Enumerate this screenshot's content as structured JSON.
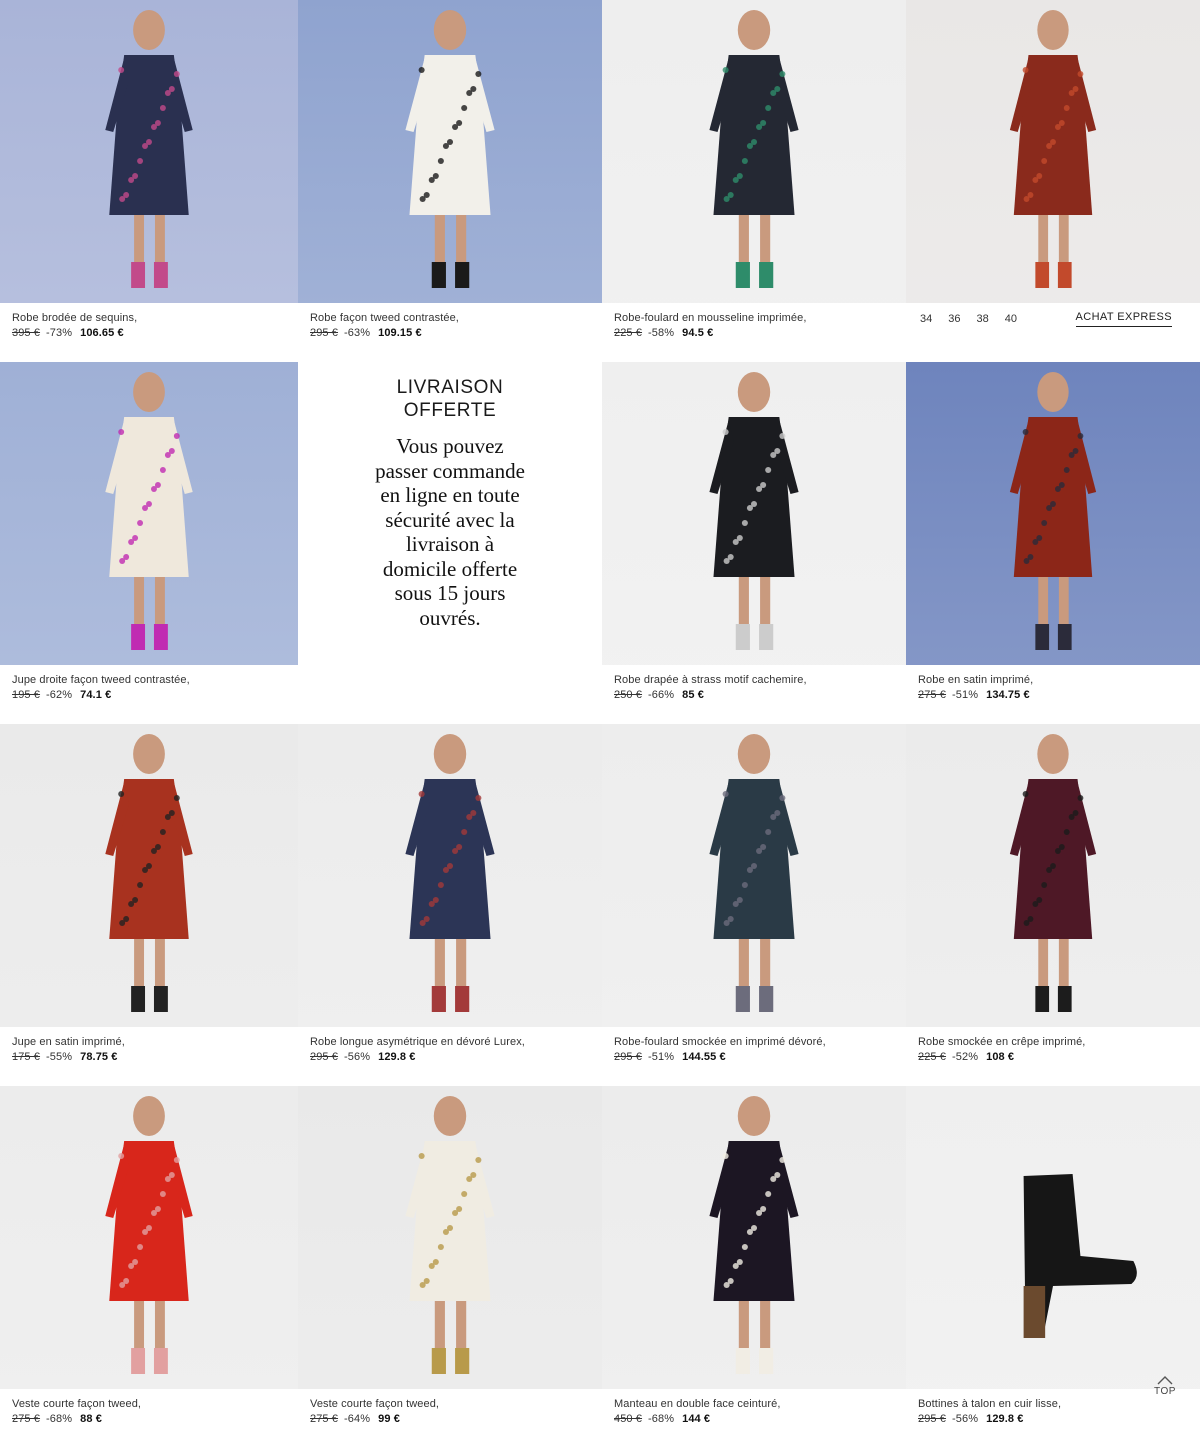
{
  "products": [
    {
      "name": "Robe brodée de sequins,",
      "old_price": "395 €",
      "discount": "-73%",
      "price": "106.65 €",
      "bg": "#a9b4d8",
      "garment": "#2a3050",
      "accent": "#c24a8a",
      "icon": "sequin-dress-photo"
    },
    {
      "name": "Robe façon tweed contrastée,",
      "old_price": "295 €",
      "discount": "-63%",
      "price": "109.15 €",
      "bg": "#8fa3cf",
      "garment": "#f2f0ea",
      "accent": "#1a1a1a",
      "icon": "tweed-dress-photo"
    },
    {
      "name": "Robe-foulard en mousseline imprimée,",
      "old_price": "225 €",
      "discount": "-58%",
      "price": "94.5 €",
      "bg": "#eeeeee",
      "garment": "#242833",
      "accent": "#2e8c6a",
      "icon": "chiffon-dress-photo"
    },
    {
      "name": "",
      "old_price": "",
      "discount": "",
      "price": "",
      "bg": "#e9e7e6",
      "garment": "#8a2a1c",
      "accent": "#c24a2c",
      "icon": "red-print-dress-photo"
    },
    {
      "name": "Jupe droite façon tweed contrastée,",
      "old_price": "195 €",
      "discount": "-62%",
      "price": "74.1 €",
      "bg": "#9fb0d6",
      "garment": "#efe8dc",
      "accent": "#c02bb2",
      "icon": "tweed-skirt-photo"
    },
    {
      "name": "Robe drapée à strass motif cachemire,",
      "old_price": "250 €",
      "discount": "-66%",
      "price": "85 €",
      "bg": "#efefef",
      "garment": "#1b1c20",
      "accent": "#cccccc",
      "icon": "draped-dress-photo"
    },
    {
      "name": "Robe en satin imprimé,",
      "old_price": "275 €",
      "discount": "-51%",
      "price": "134.75 €",
      "bg": "#6e84bd",
      "garment": "#8c2618",
      "accent": "#2b2b3a",
      "icon": "satin-dress-photo"
    },
    {
      "name": "Jupe en satin imprimé,",
      "old_price": "175 €",
      "discount": "-55%",
      "price": "78.75 €",
      "bg": "#eaeaea",
      "garment": "#a8321f",
      "accent": "#222222",
      "icon": "satin-skirt-photo"
    },
    {
      "name": "Robe longue asymétrique en dévoré Lurex,",
      "old_price": "295 €",
      "discount": "-56%",
      "price": "129.8 €",
      "bg": "#ececec",
      "garment": "#2c3556",
      "accent": "#a33a3a",
      "icon": "long-dress-photo"
    },
    {
      "name": "Robe-foulard smockée en imprimé dévoré,",
      "old_price": "295 €",
      "discount": "-51%",
      "price": "144.55 €",
      "bg": "#ededed",
      "garment": "#2a3a46",
      "accent": "#6c6c7c",
      "icon": "smocked-scarf-dress-photo"
    },
    {
      "name": "Robe smockée en crêpe imprimé,",
      "old_price": "225 €",
      "discount": "-52%",
      "price": "108 €",
      "bg": "#ebebeb",
      "garment": "#4e1826",
      "accent": "#1c1c1c",
      "icon": "smocked-crepe-dress-photo"
    },
    {
      "name": "Veste courte façon tweed,",
      "old_price": "275 €",
      "discount": "-68%",
      "price": "88 €",
      "bg": "#ececec",
      "garment": "#d8261b",
      "accent": "#e2a0a0",
      "icon": "red-tweed-jacket-photo"
    },
    {
      "name": "Veste courte façon tweed,",
      "old_price": "275 €",
      "discount": "-64%",
      "price": "99 €",
      "bg": "#e9e9e9",
      "garment": "#f0ece2",
      "accent": "#b89a4a",
      "icon": "white-tweed-jacket-photo"
    },
    {
      "name": "Manteau en double face ceinturé,",
      "old_price": "450 €",
      "discount": "-68%",
      "price": "144 €",
      "bg": "#ececec",
      "garment": "#1c1623",
      "accent": "#f1ede4",
      "icon": "coat-photo"
    },
    {
      "name": "Bottines à talon en cuir lisse,",
      "old_price": "295 €",
      "discount": "-56%",
      "price": "129.8 €",
      "bg": "#efefef",
      "garment": "#161616",
      "accent": "#6b4a2e",
      "icon": "ankle-boot-photo"
    }
  ],
  "quick_buy": {
    "sizes": [
      "34",
      "36",
      "38",
      "40"
    ],
    "label": "ACHAT EXPRESS"
  },
  "promo": {
    "title": "LIVRAISON\nOFFERTE",
    "text": "Vous pouvez passer commande en ligne en toute sécurité avec la livraison à domicile offerte sous 15 jours ouvrés."
  },
  "top_button": {
    "label": "TOP",
    "icon": "chevron-up-icon"
  }
}
